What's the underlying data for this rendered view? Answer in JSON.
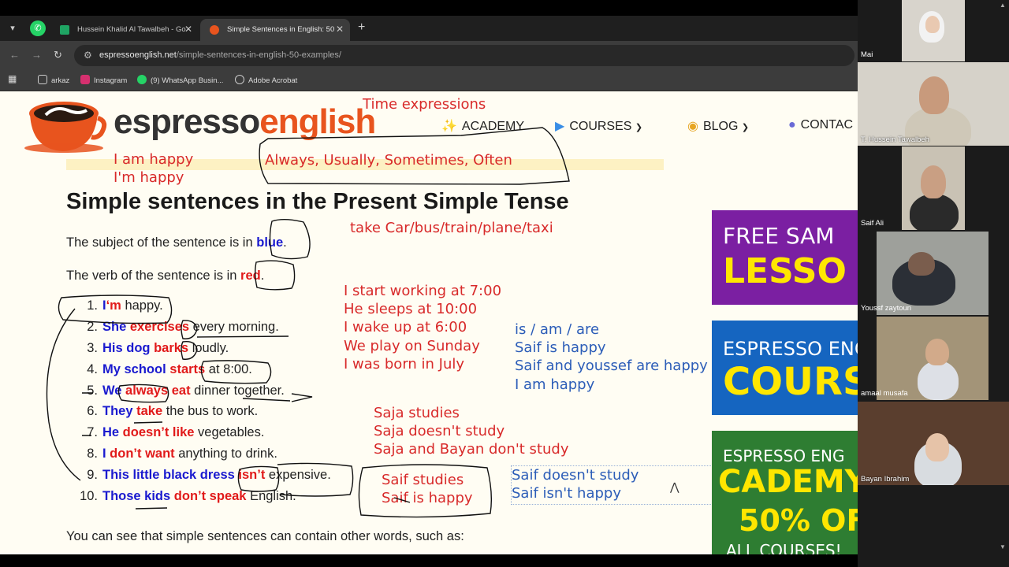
{
  "browser": {
    "tabs": [
      {
        "label": "Hussein Khalid Al Tawalbeh - Go",
        "favicon_color": "#1fa463"
      },
      {
        "label": "Simple Sentences in English: 50",
        "favicon_color": "#e8541e"
      }
    ],
    "pinned_tab_icon": "whatsapp-icon",
    "url_host": "espressoenglish.net",
    "url_path": "/simple-sentences-in-english-50-examples/",
    "bookmarks": [
      {
        "label": "arkaz",
        "icon": "folder-icon"
      },
      {
        "label": "Instagram",
        "icon": "instagram-icon"
      },
      {
        "label": "(9) WhatsApp Busin...",
        "icon": "whatsapp-icon"
      },
      {
        "label": "Adobe Acrobat",
        "icon": "acrobat-icon"
      }
    ]
  },
  "site": {
    "logo_main": "espresso",
    "logo_accent": "english",
    "nav": [
      {
        "label": "ACADEMY",
        "icon": "sparkle-icon",
        "has_dropdown": false
      },
      {
        "label": "COURSES",
        "icon": "play-icon",
        "has_dropdown": true
      },
      {
        "label": "BLOG",
        "icon": "bulb-icon",
        "has_dropdown": true
      },
      {
        "label": "CONTAC",
        "icon": "contact-icon",
        "has_dropdown": false
      }
    ],
    "heading": "Simple sentences in the Present Simple Tense",
    "subject_line": {
      "before": "The subject of the sentence is in ",
      "colored": "blue",
      "after": "."
    },
    "verb_line": {
      "before": "The verb of the sentence is in ",
      "colored": "red",
      "after": "."
    },
    "sentences": [
      {
        "n": "1.",
        "subject": "I",
        "verb": "‘m",
        "rest": " happy."
      },
      {
        "n": "2.",
        "subject": "She",
        "verb": " exercises",
        "rest": " every morning."
      },
      {
        "n": "3.",
        "subject": "His dog",
        "verb": " barks",
        "rest": " loudly."
      },
      {
        "n": "4.",
        "subject": "My school",
        "verb": " starts",
        "rest": " at 8:00."
      },
      {
        "n": "5.",
        "subject": "We",
        "verb": " always eat",
        "rest": " dinner together."
      },
      {
        "n": "6.",
        "subject": "They",
        "verb": " take",
        "rest": " the bus to work."
      },
      {
        "n": "7.",
        "subject": "He",
        "verb": " doesn’t like",
        "rest": " vegetables."
      },
      {
        "n": "8.",
        "subject": "I",
        "verb": " don’t want",
        "rest": " anything to drink."
      },
      {
        "n": "9.",
        "subject": "This little black dress",
        "verb": " isn’t",
        "rest": " expensive."
      },
      {
        "n": "10.",
        "subject": "Those kids",
        "verb": " don’t speak",
        "rest": " English."
      }
    ],
    "footer_line": "You can see that simple sentences can contain other words, such as:",
    "ads": [
      {
        "line1": "FREE SAM",
        "line2": "LESSO",
        "bg": "#7b1fa2"
      },
      {
        "line1": "ESPRESSO ENG",
        "line2": "COURS",
        "bg": "#1565c0"
      },
      {
        "line1": "ESPRESSO ENG",
        "line2": "CADEMY.",
        "line3": "50% OFF",
        "line4": "ALL COURSES!",
        "bg": "#2e7d32"
      }
    ]
  },
  "annotations": {
    "time_expressions_title": "Time expressions",
    "time_expressions_list": "Always, Usually, Sometimes, Often",
    "i_am_happy": "I am happy",
    "im_happy": "I'm happy",
    "transport": "take Car/bus/train/plane/taxi",
    "examples": [
      "I start working at 7:00",
      "He sleeps at 10:00",
      "I wake up at 6:00",
      "We play on Sunday",
      "I was born in July"
    ],
    "be_verbs": [
      "is / am / are",
      "Saif is happy",
      "Saif and youssef are happy",
      "I am happy"
    ],
    "saja": [
      "Saja studies",
      "Saja doesn't study",
      "Saja and Bayan don't study"
    ],
    "saif_box": [
      "Saif studies",
      "Saif is happy"
    ],
    "saif_neg": [
      "Saif doesn't study",
      "Saif isn't happy"
    ]
  },
  "participants": [
    {
      "name": "Mai",
      "bg": "#d8d4cc",
      "skin": "#e9c9b1",
      "cloth": "#f2f2f2"
    },
    {
      "name": "T. Hussein Tawalbeh",
      "bg": "#d6d2c9",
      "skin": "#c89a7c",
      "cloth": "#cfc8b8"
    },
    {
      "name": "Saif Ali",
      "bg": "#c9c2b4",
      "skin": "#c99f83",
      "cloth": "#2a2a2a"
    },
    {
      "name": "Youssf zaytoun",
      "bg": "#9ea09b",
      "skin": "#7a5d4d",
      "cloth": "#2b2f36"
    },
    {
      "name": "amaal musafa",
      "bg": "#a39478",
      "skin": "#d2aa8a",
      "cloth": "#dde0e6"
    },
    {
      "name": "Bayan Ibrahim",
      "bg": "#5a3e2e",
      "skin": "#e6c3a8",
      "cloth": "#d8dce0"
    }
  ]
}
